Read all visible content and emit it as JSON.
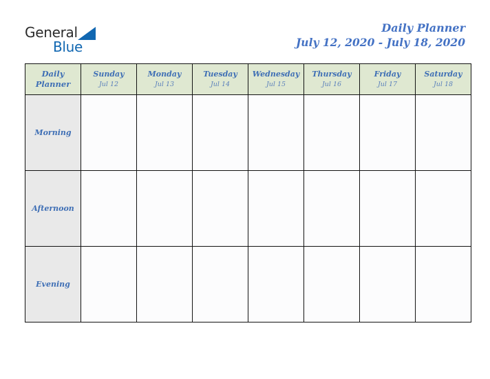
{
  "brand": {
    "name_part1": "General",
    "name_part2": "Blue",
    "triangle_icon": "blue-triangle-icon",
    "part1_color": "#2b2b2b",
    "part2_color": "#1167b1"
  },
  "header": {
    "title": "Daily Planner",
    "date_range": "July 12, 2020 - July 18, 2020",
    "title_color": "#4472c4"
  },
  "planner": {
    "corner_label_line1": "Daily",
    "corner_label_line2": "Planner",
    "header_bg": "#dfe8d1",
    "label_bg": "#e9e9e9",
    "cell_bg": "#fcfcfd",
    "border_color": "#111111",
    "text_color": "#3f6fb5",
    "columns": [
      {
        "day": "Sunday",
        "date": "Jul 12"
      },
      {
        "day": "Monday",
        "date": "Jul 13"
      },
      {
        "day": "Tuesday",
        "date": "Jul 14"
      },
      {
        "day": "Wednesday",
        "date": "Jul 15"
      },
      {
        "day": "Thursday",
        "date": "Jul 16"
      },
      {
        "day": "Friday",
        "date": "Jul 17"
      },
      {
        "day": "Saturday",
        "date": "Jul 18"
      }
    ],
    "rows": [
      {
        "label": "Morning",
        "entries": [
          "",
          "",
          "",
          "",
          "",
          "",
          ""
        ]
      },
      {
        "label": "Afternoon",
        "entries": [
          "",
          "",
          "",
          "",
          "",
          "",
          ""
        ]
      },
      {
        "label": "Evening",
        "entries": [
          "",
          "",
          "",
          "",
          "",
          "",
          ""
        ]
      }
    ]
  }
}
